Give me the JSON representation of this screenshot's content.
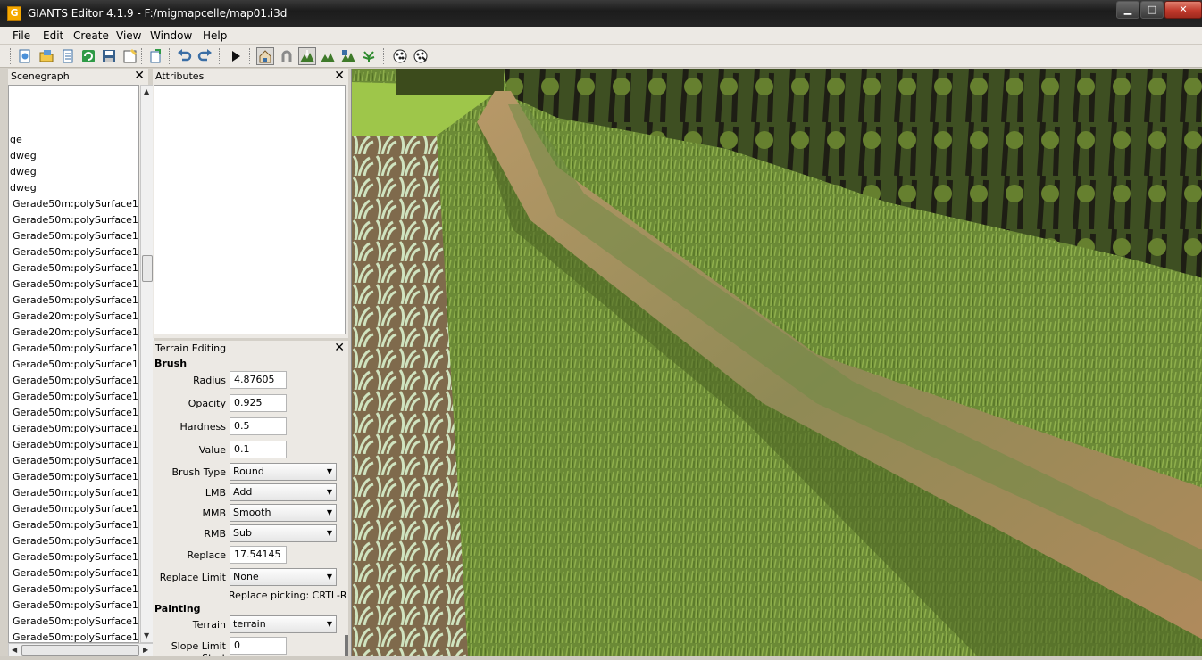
{
  "window": {
    "title": "GIANTS Editor 4.1.9 - F:/migmapcelle/map01.i3d",
    "app_icon_glyph": "G",
    "buttons": {
      "minimize": "▁",
      "maximize": "□",
      "close": "✕"
    }
  },
  "menu": {
    "items": [
      "File",
      "Edit",
      "Create",
      "View",
      "Window",
      "Help"
    ],
    "underline": [
      "F",
      "E",
      "C",
      "V",
      "W",
      "H"
    ]
  },
  "toolbar": {
    "icons": [
      "new-icon",
      "open-icon",
      "document-icon",
      "refresh-icon",
      "save-icon",
      "save-as-icon",
      "import-icon",
      "undo-icon",
      "redo-icon",
      "play-icon",
      "select-tool-icon",
      "magnet-icon",
      "terrain-sculpt-icon",
      "terrain-paint-icon",
      "foliage-icon",
      "foliage-paint-icon",
      "placement-icon",
      "placement-remove-icon"
    ],
    "active": [
      "select-tool-icon",
      "terrain-sculpt-icon"
    ]
  },
  "scenegraph": {
    "title": "Scenegraph",
    "close": "✕",
    "items": [
      "ge",
      "dweg",
      "dweg",
      "dweg",
      "Gerade50m:polySurface1",
      "Gerade50m:polySurface1",
      "Gerade50m:polySurface1",
      "Gerade50m:polySurface1",
      "Gerade50m:polySurface1",
      "Gerade50m:polySurface1",
      "Gerade50m:polySurface1",
      "Gerade20m:polySurface1",
      "Gerade20m:polySurface1",
      "Gerade50m:polySurface1",
      "Gerade50m:polySurface1",
      "Gerade50m:polySurface1",
      "Gerade50m:polySurface1",
      "Gerade50m:polySurface1",
      "Gerade50m:polySurface1",
      "Gerade50m:polySurface1",
      "Gerade50m:polySurface1",
      "Gerade50m:polySurface1",
      "Gerade50m:polySurface1",
      "Gerade50m:polySurface1",
      "Gerade50m:polySurface1",
      "Gerade50m:polySurface1",
      "Gerade50m:polySurface1",
      "Gerade50m:polySurface1",
      "Gerade50m:polySurface1",
      "Gerade50m:polySurface1",
      "Gerade50m:polySurface1",
      "Gerade50m:polySurface1",
      "Gerade50m:polySurface1",
      "Gerade50m:polySurface1"
    ]
  },
  "attributes": {
    "title": "Attributes",
    "close": "✕"
  },
  "terrain_editing": {
    "title": "Terrain Editing",
    "close": "✕",
    "brush_section": "Brush",
    "radius": {
      "label": "Radius",
      "value": "4.87605"
    },
    "opacity": {
      "label": "Opacity",
      "value": "0.925"
    },
    "hardness": {
      "label": "Hardness",
      "value": "0.5"
    },
    "value": {
      "label": "Value",
      "value": "0.1"
    },
    "brush_type": {
      "label": "Brush Type",
      "value": "Round"
    },
    "lmb": {
      "label": "LMB",
      "value": "Add"
    },
    "mmb": {
      "label": "MMB",
      "value": "Smooth"
    },
    "rmb": {
      "label": "RMB",
      "value": "Sub"
    },
    "replace": {
      "label": "Replace",
      "value": "17.54145"
    },
    "replace_limit": {
      "label": "Replace Limit",
      "value": "None"
    },
    "replace_note": "Replace picking: CRTL-R",
    "painting_section": "Painting",
    "terrain": {
      "label": "Terrain",
      "value": "terrain"
    },
    "slope_limit_start": {
      "label": "Slope Limit Start",
      "value": "0"
    }
  },
  "colors": {
    "grass": "#6f8f3a",
    "dirt_road": "#a98a5c",
    "forest": "#3a4a20",
    "title_bar": "#1f1f1f",
    "close_button": "#c0392b"
  }
}
